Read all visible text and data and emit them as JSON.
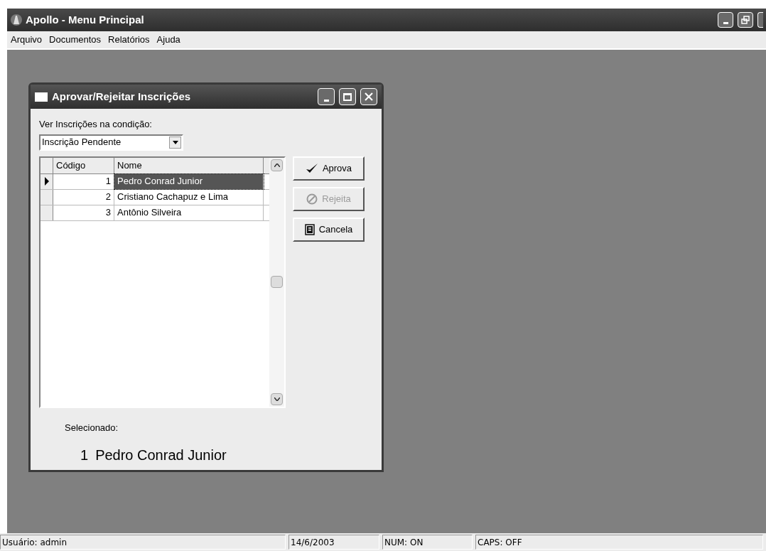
{
  "window": {
    "title": "Apollo - Menu Principal"
  },
  "menu": [
    "Arquivo",
    "Documentos",
    "Relatórios",
    "Ajuda"
  ],
  "dialog": {
    "title": "Aprovar/Rejeitar Inscrições",
    "filter_label": "Ver Inscrições na condição:",
    "filter_value": "Inscrição Pendente",
    "table": {
      "columns": [
        "Código",
        "Nome"
      ],
      "rows": [
        {
          "codigo": "1",
          "nome": "Pedro Conrad Junior",
          "selected": true
        },
        {
          "codigo": "2",
          "nome": "Cristiano Cachapuz e Lima",
          "selected": false
        },
        {
          "codigo": "3",
          "nome": "Antônio Silveira",
          "selected": false
        }
      ]
    },
    "buttons": [
      {
        "kind": "approve",
        "label": "Aprova",
        "disabled": false
      },
      {
        "kind": "reject",
        "label": "Rejeita",
        "disabled": true
      },
      {
        "kind": "cancel",
        "label": "Cancela",
        "disabled": false
      }
    ],
    "selected_label": "Selecionado:",
    "selected_code": "1",
    "selected_name": "Pedro Conrad Junior"
  },
  "status_bar": [
    "Usuário: admin",
    "14/6/2003",
    "NUM: ON",
    "CAPS: OFF"
  ]
}
